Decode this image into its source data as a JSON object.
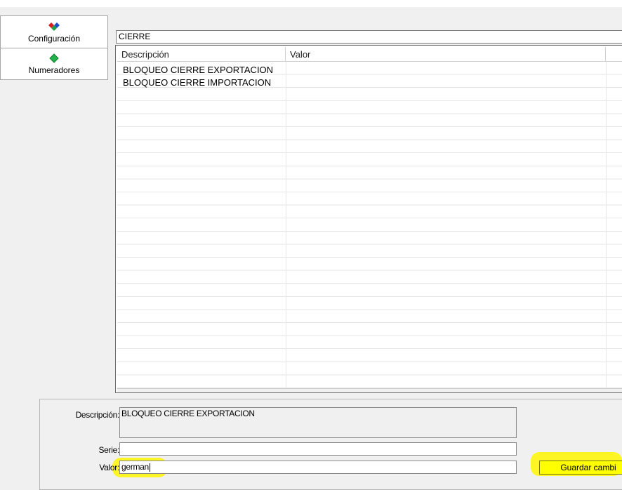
{
  "nav": {
    "items": [
      {
        "label": "Configuración",
        "icon": "diamond-multicolor-icon",
        "selected": true
      },
      {
        "label": "Numeradores",
        "icon": "diamond-green-icon",
        "selected": false
      }
    ]
  },
  "category": {
    "value": "CIERRE"
  },
  "grid": {
    "columns": [
      "Descripción",
      "Valor"
    ],
    "rows": [
      {
        "descripcion": "BLOQUEO CIERRE EXPORTACION",
        "valor": ""
      },
      {
        "descripcion": "BLOQUEO CIERRE IMPORTACION",
        "valor": ""
      }
    ]
  },
  "detail": {
    "descripcion_label": "Descripción:",
    "descripcion_value": "BLOQUEO CIERRE EXPORTACION",
    "serie_label": "Serie:",
    "serie_value": "",
    "valor_label": "Valor:",
    "valor_value": "german",
    "save_label": "Guardar cambi"
  },
  "colors": {
    "highlight": "#fff700",
    "button": "#ffff00"
  }
}
